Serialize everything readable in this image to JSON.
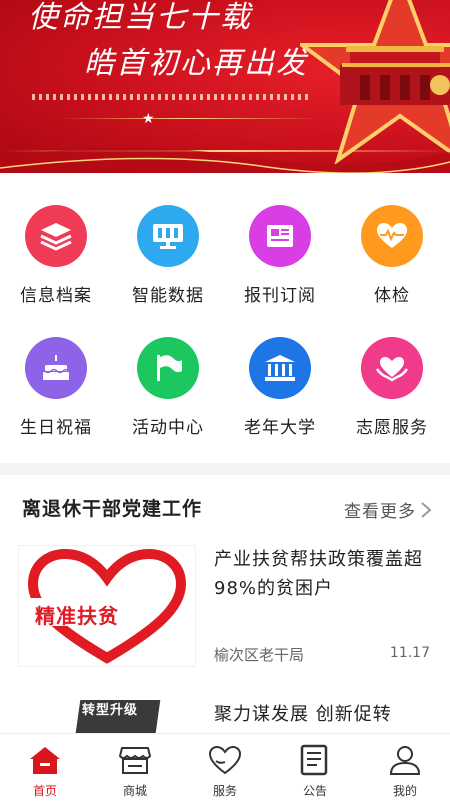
{
  "banner": {
    "line1": "使命担当七十载",
    "line2": "皓首初心再出发"
  },
  "grid": [
    {
      "label": "信息档案",
      "icon": "layers-icon",
      "color": "#ef3b55"
    },
    {
      "label": "智能数据",
      "icon": "monitor-icon",
      "color": "#2ea9ef"
    },
    {
      "label": "报刊订阅",
      "icon": "newspaper-icon",
      "color": "#d83ee3"
    },
    {
      "label": "体检",
      "icon": "heart-pulse-icon",
      "color": "#ff9a1f"
    },
    {
      "label": "生日祝福",
      "icon": "cake-icon",
      "color": "#8d63e8"
    },
    {
      "label": "活动中心",
      "icon": "flag-icon",
      "color": "#1cc760"
    },
    {
      "label": "老年大学",
      "icon": "university-icon",
      "color": "#1e76e6"
    },
    {
      "label": "志愿服务",
      "icon": "hands-heart-icon",
      "color": "#ef3b8a"
    }
  ],
  "section": {
    "title": "离退休干部党建工作",
    "more": "查看更多"
  },
  "news": [
    {
      "title": "产业扶贫帮扶政策覆盖超98%的贫困户",
      "thumb_text": "精准扶贫",
      "source": "榆次区老干局",
      "date": "11.17"
    },
    {
      "title": "聚力谋发展 创新促转",
      "thumb_text": "转型升级"
    }
  ],
  "tabbar": [
    {
      "label": "首页",
      "icon": "home-icon",
      "active": true
    },
    {
      "label": "商城",
      "icon": "store-icon",
      "active": false
    },
    {
      "label": "服务",
      "icon": "heart-outline-icon",
      "active": false
    },
    {
      "label": "公告",
      "icon": "notice-icon",
      "active": false
    },
    {
      "label": "我的",
      "icon": "user-icon",
      "active": false
    }
  ],
  "colors": {
    "brand_red": "#d7161e"
  }
}
